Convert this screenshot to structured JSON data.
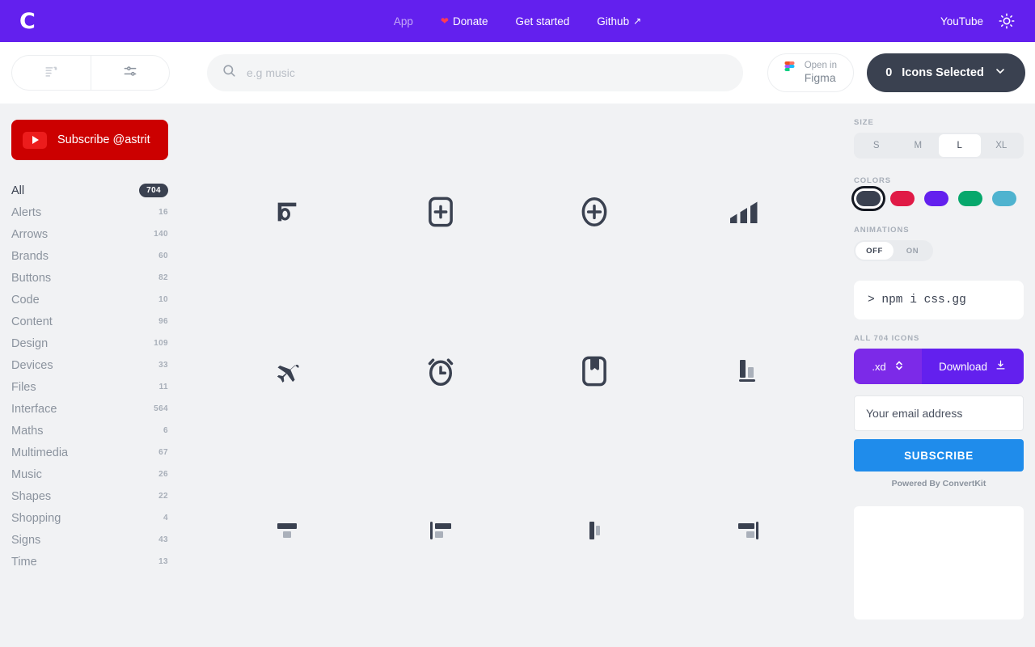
{
  "header": {
    "logo": "C",
    "nav": [
      {
        "label": "App",
        "icon": "",
        "trailing": "",
        "dim": true
      },
      {
        "label": "Donate",
        "icon": "❤",
        "trailing": "",
        "dim": false
      },
      {
        "label": "Get started",
        "icon": "",
        "trailing": "",
        "dim": false
      },
      {
        "label": "Github",
        "icon": "",
        "trailing": "↗",
        "dim": false
      }
    ],
    "youtube_label": "YouTube",
    "theme_icon": "sun-icon",
    "background": "#6320ee"
  },
  "toolbar": {
    "view_list_icon": "list-sort-icon",
    "view_options_icon": "sliders-options-icon",
    "search": {
      "placeholder": "e.g music",
      "value": "",
      "icon": "search-icon"
    },
    "figma": {
      "small": "Open in",
      "big": "Figma",
      "icon": "figma-icon"
    },
    "selection": {
      "count": "0",
      "label": "Icons Selected",
      "chevron": "chevron-down-icon"
    }
  },
  "sidebar": {
    "subscribe": {
      "label": "Subscribe @astrit",
      "icon": "youtube-play-icon",
      "color": "#cc0000"
    },
    "categories": [
      {
        "label": "All",
        "count": "704",
        "active": true
      },
      {
        "label": "Alerts",
        "count": "16",
        "active": false
      },
      {
        "label": "Arrows",
        "count": "140",
        "active": false
      },
      {
        "label": "Brands",
        "count": "60",
        "active": false
      },
      {
        "label": "Buttons",
        "count": "82",
        "active": false
      },
      {
        "label": "Code",
        "count": "10",
        "active": false
      },
      {
        "label": "Content",
        "count": "96",
        "active": false
      },
      {
        "label": "Design",
        "count": "109",
        "active": false
      },
      {
        "label": "Devices",
        "count": "33",
        "active": false
      },
      {
        "label": "Files",
        "count": "11",
        "active": false
      },
      {
        "label": "Interface",
        "count": "564",
        "active": false
      },
      {
        "label": "Maths",
        "count": "6",
        "active": false
      },
      {
        "label": "Multimedia",
        "count": "67",
        "active": false
      },
      {
        "label": "Music",
        "count": "26",
        "active": false
      },
      {
        "label": "Shapes",
        "count": "22",
        "active": false
      },
      {
        "label": "Shopping",
        "count": "4",
        "active": false
      },
      {
        "label": "Signs",
        "count": "43",
        "active": false
      },
      {
        "label": "Time",
        "count": "13",
        "active": false
      }
    ]
  },
  "grid": {
    "icons": [
      {
        "name": "abstract-logo-icon"
      },
      {
        "name": "add-rounded-square-icon"
      },
      {
        "name": "add-circle-icon"
      },
      {
        "name": "adidas-logo-icon"
      },
      {
        "name": "airplane-icon"
      },
      {
        "name": "alarm-icon"
      },
      {
        "name": "album-bookmark-icon"
      },
      {
        "name": "align-bottom-icon"
      },
      {
        "name": "align-center-icon"
      },
      {
        "name": "align-left-icon"
      },
      {
        "name": "align-vertical-left-icon"
      },
      {
        "name": "align-right-icon"
      }
    ]
  },
  "rightpanel": {
    "size_label": "SIZE",
    "sizes": [
      {
        "label": "S",
        "active": false
      },
      {
        "label": "M",
        "active": false
      },
      {
        "label": "L",
        "active": true
      },
      {
        "label": "XL",
        "active": false
      }
    ],
    "colors_label": "COLORS",
    "colors": [
      {
        "hex": "#3a4150",
        "selected": true
      },
      {
        "hex": "#e01a46",
        "selected": false
      },
      {
        "hex": "#6320ee",
        "selected": false
      },
      {
        "hex": "#07a86c",
        "selected": false
      },
      {
        "hex": "#4fb3cf",
        "selected": false
      }
    ],
    "animations_label": "ANIMATIONS",
    "animations": [
      {
        "label": "OFF",
        "active": true
      },
      {
        "label": "ON",
        "active": false
      }
    ],
    "npm_command": "> npm i css.gg",
    "download_label_all": "ALL 704 ICONS",
    "download_format": ".xd",
    "download_button": "Download",
    "download_icon": "download-icon",
    "email_placeholder": "Your email address",
    "email_value": "",
    "subscribe_button": "SUBSCRIBE",
    "powered_by": "Powered By ConvertKit"
  }
}
